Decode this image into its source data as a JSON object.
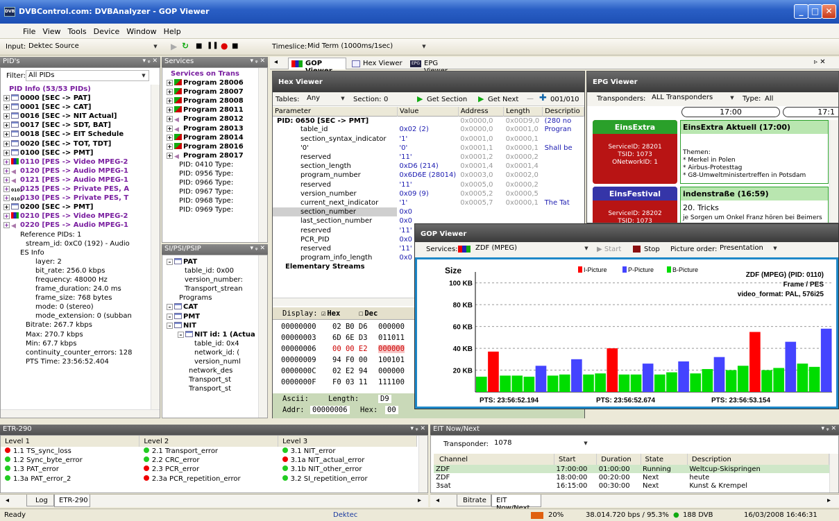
{
  "app": {
    "title": "DVBControl.com: DVBAnalyzer - GOP Viewer",
    "icon": "DVB"
  },
  "menu": [
    "File",
    "View",
    "Tools",
    "Device",
    "Window",
    "Help"
  ],
  "toolbar": {
    "input_label": "Input:",
    "input_value": "Dektec Source",
    "timeslice_label": "Timeslice:",
    "timeslice_value": "Mid Term (1000ms/1sec)"
  },
  "pids": {
    "header": "PID's",
    "filter_label": "Filter:",
    "filter_value": "All PIDs",
    "items": [
      {
        "t": "PID Info (53/53 PIDs)",
        "i": "",
        "c": "#7a1fa0",
        "x": 10
      },
      {
        "t": "0000 [SEC -> PAT]",
        "i": "tbl",
        "c": "#000",
        "x": 2
      },
      {
        "t": "0001 [SEC -> CAT]",
        "i": "tbl",
        "c": "#000",
        "x": 2
      },
      {
        "t": "0016 [SEC -> NIT Actual]",
        "i": "tbl",
        "c": "#000",
        "x": 2
      },
      {
        "t": "0017 [SEC -> SDT, BAT]",
        "i": "tbl",
        "c": "#000",
        "x": 2
      },
      {
        "t": "0018 [SEC -> EIT Schedule",
        "i": "tbl",
        "c": "#000",
        "x": 2
      },
      {
        "t": "0020 [SEC -> TOT, TDT]",
        "i": "tbl",
        "c": "#000",
        "x": 2
      },
      {
        "t": "0100 [SEC -> PMT]",
        "i": "tbl",
        "c": "#000",
        "x": 2
      },
      {
        "t": "0110 [PES -> Video MPEG-2",
        "i": "vid",
        "c": "#7a1fa0",
        "x": 2
      },
      {
        "t": "0120 [PES -> Audio MPEG-1",
        "i": "aud",
        "c": "#7a1fa0",
        "x": 2
      },
      {
        "t": "0121 [PES -> Audio MPEG-1",
        "i": "aud",
        "c": "#7a1fa0",
        "x": 2
      },
      {
        "t": "0125 [PES -> Private PES, A",
        "i": "priv",
        "c": "#7a1fa0",
        "x": 2
      },
      {
        "t": "0130 [PES -> Private PES, T",
        "i": "priv",
        "c": "#7a1fa0",
        "x": 2
      },
      {
        "t": "0200 [SEC -> PMT]",
        "i": "tbl",
        "c": "#000",
        "x": 2
      },
      {
        "t": "0210 [PES -> Video MPEG-2",
        "i": "vid",
        "c": "#7a1fa0",
        "x": 2
      },
      {
        "t": "0220 [PES -> Audio MPEG-1",
        "i": "aud",
        "c": "#7a1fa0",
        "x": 2
      },
      {
        "t": "Reference PIDs: 1",
        "i": "",
        "c": "#000",
        "x": 26
      },
      {
        "t": "stream_id: 0xC0 (192) - Audio",
        "i": "",
        "c": "#000",
        "x": 34
      },
      {
        "t": "ES Info",
        "i": "",
        "c": "#000",
        "x": 26
      },
      {
        "t": "layer: 2",
        "i": "",
        "c": "#000",
        "x": 48
      },
      {
        "t": "bit_rate: 256.0 kbps",
        "i": "",
        "c": "#000",
        "x": 48
      },
      {
        "t": "frequency: 48000 Hz",
        "i": "",
        "c": "#000",
        "x": 48
      },
      {
        "t": "frame_duration: 24.0 ms",
        "i": "",
        "c": "#000",
        "x": 48
      },
      {
        "t": "frame_size: 768 bytes",
        "i": "",
        "c": "#000",
        "x": 48
      },
      {
        "t": "mode: 0 (stereo)",
        "i": "",
        "c": "#000",
        "x": 48
      },
      {
        "t": "mode_extension: 0 (subban",
        "i": "",
        "c": "#000",
        "x": 48
      },
      {
        "t": "Bitrate: 267.7 kbps",
        "i": "",
        "c": "#000",
        "x": 34
      },
      {
        "t": "Max: 270.7 kbps",
        "i": "",
        "c": "#000",
        "x": 34
      },
      {
        "t": "Min: 67.7 kbps",
        "i": "",
        "c": "#000",
        "x": 34
      },
      {
        "t": "continuity_counter_errors: 128",
        "i": "",
        "c": "#000",
        "x": 34
      },
      {
        "t": "PTS Time: 23:56:52.404",
        "i": "",
        "c": "#000",
        "x": 34
      }
    ]
  },
  "services": {
    "header": "Services",
    "items": [
      {
        "t": "Services on Trans",
        "c": "#7a1fa0",
        "i": "",
        "x": 10
      },
      {
        "t": "Program 28006",
        "c": "#000",
        "i": "prog",
        "x": 4
      },
      {
        "t": "Program 28007",
        "c": "#000",
        "i": "prog",
        "x": 4
      },
      {
        "t": "Program 28008",
        "c": "#000",
        "i": "prog",
        "x": 4
      },
      {
        "t": "Program 28011",
        "c": "#000",
        "i": "prog",
        "x": 4
      },
      {
        "t": "Program 28012",
        "c": "#000",
        "i": "aud",
        "x": 4
      },
      {
        "t": "Program 28013",
        "c": "#000",
        "i": "aud",
        "x": 4
      },
      {
        "t": "Program 28014",
        "c": "#000",
        "i": "prog",
        "x": 4
      },
      {
        "t": "Program 28016",
        "c": "#000",
        "i": "prog",
        "x": 4
      },
      {
        "t": "Program 28017",
        "c": "#000",
        "i": "aud",
        "x": 4
      },
      {
        "t": "PID: 0410 Type:",
        "c": "#000",
        "i": "",
        "x": 22
      },
      {
        "t": "PID: 0956 Type:",
        "c": "#000",
        "i": "",
        "x": 22
      },
      {
        "t": "PID: 0966 Type:",
        "c": "#000",
        "i": "",
        "x": 22
      },
      {
        "t": "PID: 0967 Type:",
        "c": "#000",
        "i": "",
        "x": 22
      },
      {
        "t": "PID: 0968 Type:",
        "c": "#000",
        "i": "",
        "x": 22
      },
      {
        "t": "PID: 0969 Type:",
        "c": "#000",
        "i": "",
        "x": 22
      }
    ]
  },
  "sipsi": {
    "header": "SI/PSI/PSIP",
    "items": [
      {
        "t": "PAT",
        "b": true,
        "x": 4
      },
      {
        "t": "table_id: 0x00",
        "b": false,
        "x": 30
      },
      {
        "t": "version_number:",
        "b": false,
        "x": 30
      },
      {
        "t": "Transport_strean",
        "b": false,
        "x": 30
      },
      {
        "t": "Programs",
        "b": false,
        "x": 22
      },
      {
        "t": "CAT",
        "b": true,
        "x": 4
      },
      {
        "t": "PMT",
        "b": true,
        "x": 4
      },
      {
        "t": "NIT",
        "b": true,
        "x": 4
      },
      {
        "t": "NIT id: 1 (Actua",
        "b": true,
        "x": 20
      },
      {
        "t": "table_id: 0x4",
        "b": false,
        "x": 44
      },
      {
        "t": "network_id: (",
        "b": false,
        "x": 44
      },
      {
        "t": "version_numl",
        "b": false,
        "x": 44
      },
      {
        "t": "network_des",
        "b": false,
        "x": 36
      },
      {
        "t": "Transport_st",
        "b": false,
        "x": 36
      },
      {
        "t": "Transport_st",
        "b": false,
        "x": 36
      }
    ]
  },
  "tabs": {
    "gop": "GOP Viewer",
    "hex": "Hex Viewer",
    "epg": "EPG Viewer"
  },
  "hex": {
    "title": "Hex Viewer",
    "tables_label": "Tables:",
    "tables_value": "Any",
    "section_label": "Section:",
    "section_value": "0",
    "get_section": "Get Section",
    "get_next": "Get Next",
    "count": "001/010",
    "cols": [
      "Parameter",
      "Value",
      "Address",
      "Length",
      "Descriptio"
    ],
    "rows": [
      [
        "PID: 0650 [SEC -> PMT]",
        "",
        "0x0000,0",
        "0x00D9,0",
        "(280 no"
      ],
      [
        "table_id",
        "0x02 (2)",
        "0x0000,0",
        "0x0001,0",
        "Progran"
      ],
      [
        "section_syntax_indicator",
        "'1'",
        "0x0001,0",
        "0x0000,1",
        ""
      ],
      [
        "'0'",
        "'0'",
        "0x0001,1",
        "0x0000,1",
        "Shall be"
      ],
      [
        "reserved",
        "'11'",
        "0x0001,2",
        "0x0000,2",
        ""
      ],
      [
        "section_length",
        "0xD6 (214)",
        "0x0001,4",
        "0x0001,4",
        ""
      ],
      [
        "program_number",
        "0x6D6E (28014)",
        "0x0003,0",
        "0x0002,0",
        ""
      ],
      [
        "reserved",
        "'11'",
        "0x0005,0",
        "0x0000,2",
        ""
      ],
      [
        "version_number",
        "0x09 (9)",
        "0x0005,2",
        "0x0000,5",
        ""
      ],
      [
        "current_next_indicator",
        "'1'",
        "0x0005,7",
        "0x0000,1",
        "The Tat"
      ],
      [
        "section_number",
        "0x0",
        "",
        "",
        ""
      ],
      [
        "last_section_number",
        "0x0",
        "",
        "",
        ""
      ],
      [
        "reserved",
        "'11'",
        "",
        "",
        ""
      ],
      [
        "PCR_PID",
        "0x0",
        "",
        "",
        ""
      ],
      [
        "reserved",
        "'11'",
        "",
        "",
        ""
      ],
      [
        "program_info_length",
        "0x0",
        "",
        "",
        ""
      ],
      [
        "Elementary Streams",
        "",
        "",
        "",
        ""
      ]
    ],
    "display_label": "Display:",
    "hex_opt": "Hex",
    "dec_opt": "Dec",
    "dump": [
      [
        "00000000",
        "02 B0 D6",
        "000000"
      ],
      [
        "00000003",
        "6D 6E D3",
        "011011"
      ],
      [
        "00000006",
        "00 00 E2",
        "000000"
      ],
      [
        "00000009",
        "94 F0 00",
        "100101"
      ],
      [
        "0000000C",
        "02 E2 94",
        "000000"
      ],
      [
        "0000000F",
        "F0 03 11",
        "111100"
      ]
    ],
    "ascii_label": "Ascii:",
    "length_label": "Length:",
    "length_value": "D9",
    "addr_label": "Addr:",
    "addr_value": "00000006",
    "hex_label": "Hex:",
    "hex_value": "00"
  },
  "epg": {
    "title": "EPG Viewer",
    "transponders_label": "Transponders:",
    "transponders_value": "ALL Transponders",
    "type_label": "Type:",
    "type_value": "All",
    "time1": "17:00",
    "time2": "17:1",
    "ch1": {
      "name": "EinsExtra",
      "service": "ServiceID: 28201",
      "tsid": "TSID: 1073",
      "onid": "ONetworkID: 1",
      "prog": "EinsExtra Aktuell (17:00)",
      "themen": "Themen:",
      "lines": [
        "* Merkel in Polen",
        "* Airbus-Protesttag",
        "* G8-Umweltministertreffen in Potsdam"
      ]
    },
    "ch2": {
      "name": "EinsFestival",
      "service": "ServiceID: 28202",
      "tsid": "TSID: 1073",
      "prog": "indenstraße (16:59)",
      "sub": "20. Tricks",
      "line": "je Sorgen um Onkel Franz hören bei Beimers"
    }
  },
  "gop": {
    "title": "GOP Viewer",
    "services_label": "Services:",
    "service_value": "ZDF (MPEG)",
    "start": "Start",
    "stop": "Stop",
    "order_label": "Picture order:",
    "order_value": "Presentation"
  },
  "chart_data": {
    "type": "bar",
    "ylabel": "Size",
    "yticks": [
      "20 KB",
      "40 KB",
      "60 KB",
      "80 KB",
      "100 KB"
    ],
    "ylim": [
      0,
      110
    ],
    "legend": [
      "I-Picture",
      "P-Picture",
      "B-Picture"
    ],
    "colors": {
      "I": "#ff0000",
      "P": "#4444ff",
      "B": "#00dd00"
    },
    "info": [
      "ZDF (MPEG) (PID: 0110)",
      "Frame / PES",
      "video_format: PAL, 576i25"
    ],
    "pts": [
      "PTS: 23:56:52.194",
      "PTS: 23:56:52.674",
      "PTS: 23:56:53.154"
    ],
    "frames": [
      [
        "B",
        14
      ],
      [
        "I",
        37
      ],
      [
        "B",
        15
      ],
      [
        "B",
        15
      ],
      [
        "B",
        14
      ],
      [
        "P",
        24
      ],
      [
        "B",
        15
      ],
      [
        "B",
        16
      ],
      [
        "P",
        30
      ],
      [
        "B",
        16
      ],
      [
        "B",
        17
      ],
      [
        "I",
        40
      ],
      [
        "B",
        16
      ],
      [
        "B",
        16
      ],
      [
        "P",
        26
      ],
      [
        "B",
        16
      ],
      [
        "B",
        18
      ],
      [
        "P",
        28
      ],
      [
        "B",
        17
      ],
      [
        "B",
        21
      ],
      [
        "P",
        32
      ],
      [
        "B",
        20
      ],
      [
        "B",
        24
      ],
      [
        "I",
        55
      ],
      [
        "B",
        20
      ],
      [
        "B",
        22
      ],
      [
        "P",
        46
      ],
      [
        "B",
        26
      ],
      [
        "B",
        23
      ],
      [
        "P",
        58
      ]
    ]
  },
  "etr": {
    "header": "ETR-290",
    "cols": [
      "Level 1",
      "Level 2",
      "Level 3"
    ],
    "rows": [
      [
        [
          "1.1 TS_sync_loss",
          "#e00"
        ],
        [
          "2.1 Transport_error",
          "#2c2"
        ],
        [
          "3.1 NIT_error",
          "#2c2"
        ]
      ],
      [
        [
          "1.2 Sync_byte_error",
          "#2c2"
        ],
        [
          "2.2 CRC_error",
          "#2c2"
        ],
        [
          "3.1a NIT_actual_error",
          "#e00"
        ]
      ],
      [
        [
          "1.3 PAT_error",
          "#2c2"
        ],
        [
          "2.3 PCR_error",
          "#e00"
        ],
        [
          "3.1b NIT_other_error",
          "#2c2"
        ]
      ],
      [
        [
          "1.3a PAT_error_2",
          "#2c2"
        ],
        [
          "2.3a PCR_repetition_error",
          "#e00"
        ],
        [
          "3.2 SI_repetition_error",
          "#2c2"
        ]
      ]
    ],
    "tab_log": "Log",
    "tab_etr": "ETR-290"
  },
  "eit": {
    "header": "EIT Now/Next",
    "transponder_label": "Transponder:",
    "transponder_value": "1078",
    "cols": [
      "Channel",
      "Start",
      "Duration",
      "State",
      "Description"
    ],
    "rows": [
      [
        "ZDF",
        "17:00:00",
        "01:00:00",
        "Running",
        "Weltcup-Skispringen"
      ],
      [
        "ZDF",
        "18:00:00",
        "00:20:00",
        "Next",
        "heute"
      ],
      [
        "3sat",
        "16:15:00",
        "00:30:00",
        "Next",
        "Kunst & Krempel"
      ]
    ],
    "tab_bitrate": "Bitrate",
    "tab_eit": "EIT Now/Next"
  },
  "status": {
    "ready": "Ready",
    "device": "Dektec",
    "load": "20%",
    "bitrate": "38.014.720 bps / 95.3%",
    "dvb": "188 DVB",
    "datetime": "16/03/2008 16:46:31"
  }
}
